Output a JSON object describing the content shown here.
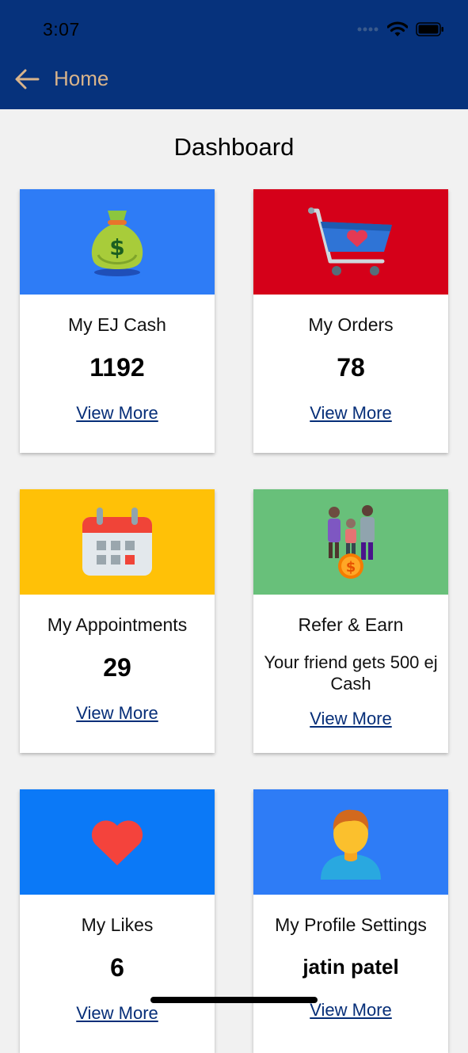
{
  "status_bar": {
    "time": "3:07"
  },
  "nav": {
    "back_icon": "arrow-left-icon",
    "title": "Home"
  },
  "page": {
    "title": "Dashboard"
  },
  "colors": {
    "header": "#06327c",
    "nav_text": "#d9b48b",
    "link": "#062e78"
  },
  "cards": [
    {
      "label": "My EJ Cash",
      "value": "1192",
      "link": "View More",
      "icon": "money-bag-icon",
      "color": "#2e7cf6"
    },
    {
      "label": "My Orders",
      "value": "78",
      "link": "View More",
      "icon": "shopping-cart-icon",
      "color": "#d50019"
    },
    {
      "label": "My Appointments",
      "value": "29",
      "link": "View More",
      "icon": "calendar-icon",
      "color": "#ffc107"
    },
    {
      "label": "Refer & Earn",
      "value": "Your friend gets 500 ej Cash",
      "link": "View More",
      "icon": "family-coin-icon",
      "color": "#68c07a"
    },
    {
      "label": "My Likes",
      "value": "6",
      "link": "View More",
      "icon": "heart-icon",
      "color": "#0b79f7"
    },
    {
      "label": "My Profile Settings",
      "value": "jatin patel",
      "link": "View More",
      "icon": "user-avatar-icon",
      "color": "#2e7cf6"
    }
  ]
}
